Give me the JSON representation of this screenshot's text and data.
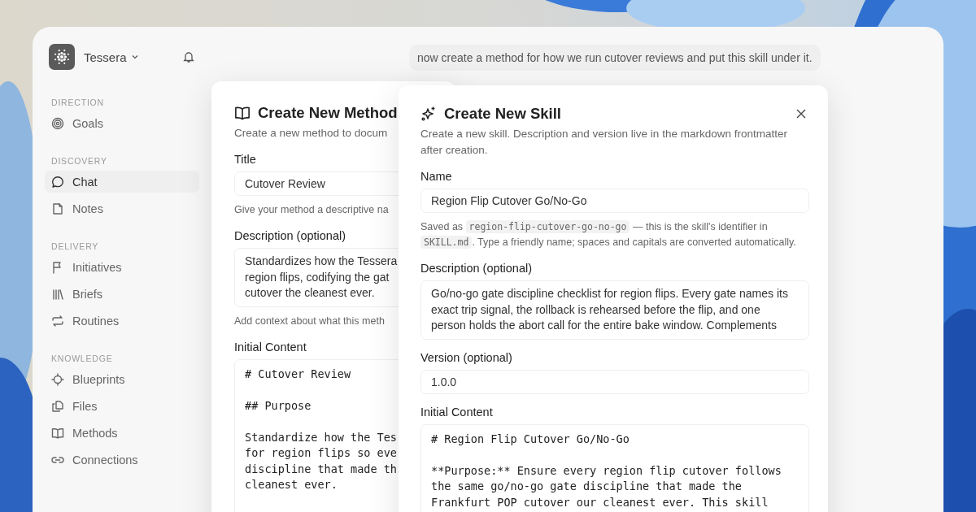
{
  "workspace": {
    "name": "Tessera"
  },
  "sidebar": {
    "sections": [
      {
        "title": "DIRECTION",
        "items": [
          {
            "label": "Goals",
            "selected": false
          }
        ]
      },
      {
        "title": "DISCOVERY",
        "items": [
          {
            "label": "Chat",
            "selected": true
          },
          {
            "label": "Notes",
            "selected": false
          }
        ]
      },
      {
        "title": "DELIVERY",
        "items": [
          {
            "label": "Initiatives",
            "selected": false
          },
          {
            "label": "Briefs",
            "selected": false
          },
          {
            "label": "Routines",
            "selected": false
          }
        ]
      },
      {
        "title": "KNOWLEDGE",
        "items": [
          {
            "label": "Blueprints",
            "selected": false
          },
          {
            "label": "Files",
            "selected": false
          },
          {
            "label": "Methods",
            "selected": false
          },
          {
            "label": "Connections",
            "selected": false
          }
        ]
      }
    ]
  },
  "chat": {
    "message": "now create a method for how we run cutover reviews and put this skill under it."
  },
  "method_dialog": {
    "title": "Create New Method",
    "subtitle": "Create a new method to docum",
    "fields": [
      {
        "kind": "input",
        "label": "Title",
        "value": "Cutover Review",
        "hint": "Give your method a descriptive na"
      },
      {
        "kind": "textarea",
        "label": "Description (optional)",
        "lines": [
          "Standardizes how the Tessera",
          "region flips, codifying the gat",
          "cutover the cleanest ever."
        ],
        "hint": "Add context about what this meth"
      },
      {
        "kind": "code",
        "label": "Initial Content",
        "blocks": [
          [
            "# Cutover Review"
          ],
          [
            "## Purpose"
          ],
          [
            "Standardize how the Tes",
            "for region flips so eve",
            "discipline that made th",
            "cleanest ever."
          ]
        ]
      }
    ]
  },
  "skill_dialog": {
    "title": "Create New Skill",
    "subtitle": "Create a new skill. Description and version live in the markdown frontmatter after creation.",
    "fields": [
      {
        "kind": "input",
        "label": "Name",
        "value": "Region Flip Cutover Go/No-Go",
        "hint_parts": [
          {
            "kind": "text",
            "text": "Saved as "
          },
          {
            "kind": "code",
            "text": "region-flip-cutover-go-no-go"
          },
          {
            "kind": "text",
            "text": " — this is the skill's identifier in "
          },
          {
            "kind": "code",
            "text": "SKILL.md"
          },
          {
            "kind": "text",
            "text": ". Type a friendly name; spaces and capitals are converted automatically."
          }
        ]
      },
      {
        "kind": "textarea",
        "label": "Description (optional)",
        "lines": [
          "Go/no-go gate discipline checklist for region flips. Every gate names its",
          "exact trip signal, the rollback is rehearsed before the flip, and one",
          "person holds the abort call for the entire bake window. Complements"
        ]
      },
      {
        "kind": "input",
        "label": "Version (optional)",
        "value": "1.0.0"
      },
      {
        "kind": "code",
        "label": "Initial Content",
        "blocks": [
          [
            "# Region Flip Cutover Go/No-Go"
          ],
          [
            "**Purpose:** Ensure every region flip cutover follows",
            "the same go/no-go gate discipline that made the",
            "Frankfurt POP cutover our cleanest ever. This skill"
          ]
        ]
      }
    ]
  }
}
